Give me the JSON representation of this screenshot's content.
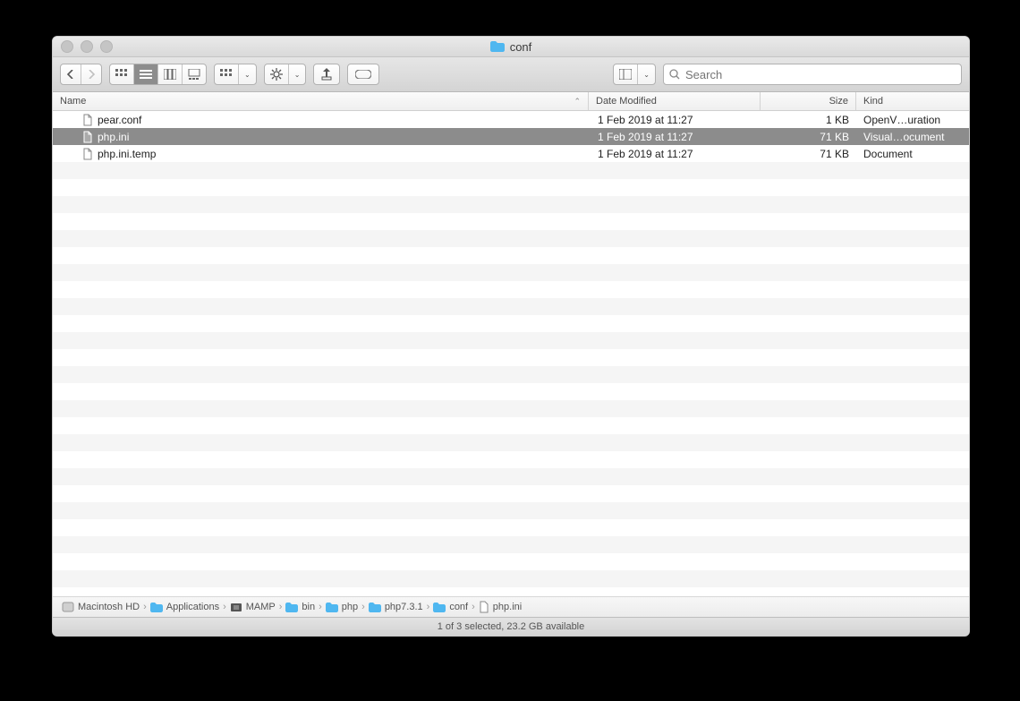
{
  "window": {
    "title": "conf"
  },
  "search": {
    "placeholder": "Search"
  },
  "columns": {
    "name": "Name",
    "date": "Date Modified",
    "size": "Size",
    "kind": "Kind"
  },
  "files": [
    {
      "name": "pear.conf",
      "date": "1 Feb 2019 at 11:27",
      "size": "1 KB",
      "kind": "OpenV…uration",
      "icon": "conf",
      "selected": false
    },
    {
      "name": "php.ini",
      "date": "1 Feb 2019 at 11:27",
      "size": "71 KB",
      "kind": "Visual…ocument",
      "icon": "ini",
      "selected": true
    },
    {
      "name": "php.ini.temp",
      "date": "1 Feb 2019 at 11:27",
      "size": "71 KB",
      "kind": "Document",
      "icon": "doc",
      "selected": false
    }
  ],
  "empty_rows": 25,
  "path": [
    {
      "label": "Macintosh HD",
      "icon": "disk"
    },
    {
      "label": "Applications",
      "icon": "folder"
    },
    {
      "label": "MAMP",
      "icon": "appfolder"
    },
    {
      "label": "bin",
      "icon": "folder"
    },
    {
      "label": "php",
      "icon": "folder"
    },
    {
      "label": "php7.3.1",
      "icon": "folder"
    },
    {
      "label": "conf",
      "icon": "folder"
    },
    {
      "label": "php.ini",
      "icon": "ini"
    }
  ],
  "status": "1 of 3 selected, 23.2 GB available"
}
